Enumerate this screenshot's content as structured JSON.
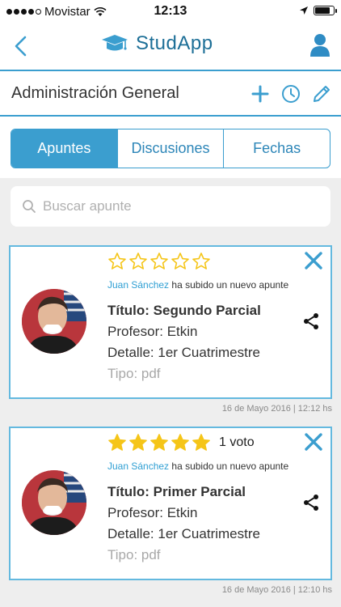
{
  "status_bar": {
    "carrier": "Movistar",
    "time": "12:13",
    "battery_level": 0.85
  },
  "header": {
    "brand_name": "StudApp",
    "back_icon": "chevron-left-icon",
    "logo_icon": "graduation-cap-icon",
    "user_icon": "user-icon"
  },
  "title_bar": {
    "subject": "Administración General",
    "actions": [
      "add-icon",
      "history-icon",
      "edit-icon"
    ]
  },
  "tabs": [
    {
      "label": "Apuntes",
      "active": true
    },
    {
      "label": "Discusiones",
      "active": false
    },
    {
      "label": "Fechas",
      "active": false
    }
  ],
  "search": {
    "placeholder": "Buscar apunte"
  },
  "colors": {
    "accent": "#3b9ecf",
    "star": "#f5c518",
    "author": "#2f9fd3"
  },
  "cards": [
    {
      "rating": 0,
      "max_rating": 5,
      "votes_label": "",
      "author": "Juan Sánchez",
      "action_text": " ha subido un nuevo apunte",
      "title": "Título: Segundo Parcial",
      "professor": "Profesor: Etkin",
      "detail": "Detalle: 1er Cuatrimestre",
      "type": "Tipo: pdf",
      "timestamp": "16 de Mayo 2016 | 12:12 hs"
    },
    {
      "rating": 5,
      "max_rating": 5,
      "votes_label": "1 voto",
      "author": "Juan Sánchez",
      "action_text": " ha subido un nuevo apunte",
      "title": "Título: Primer Parcial",
      "professor": "Profesor: Etkin",
      "detail": "Detalle: 1er Cuatrimestre",
      "type": "Tipo: pdf",
      "timestamp": "16 de Mayo 2016 | 12:10 hs"
    }
  ]
}
